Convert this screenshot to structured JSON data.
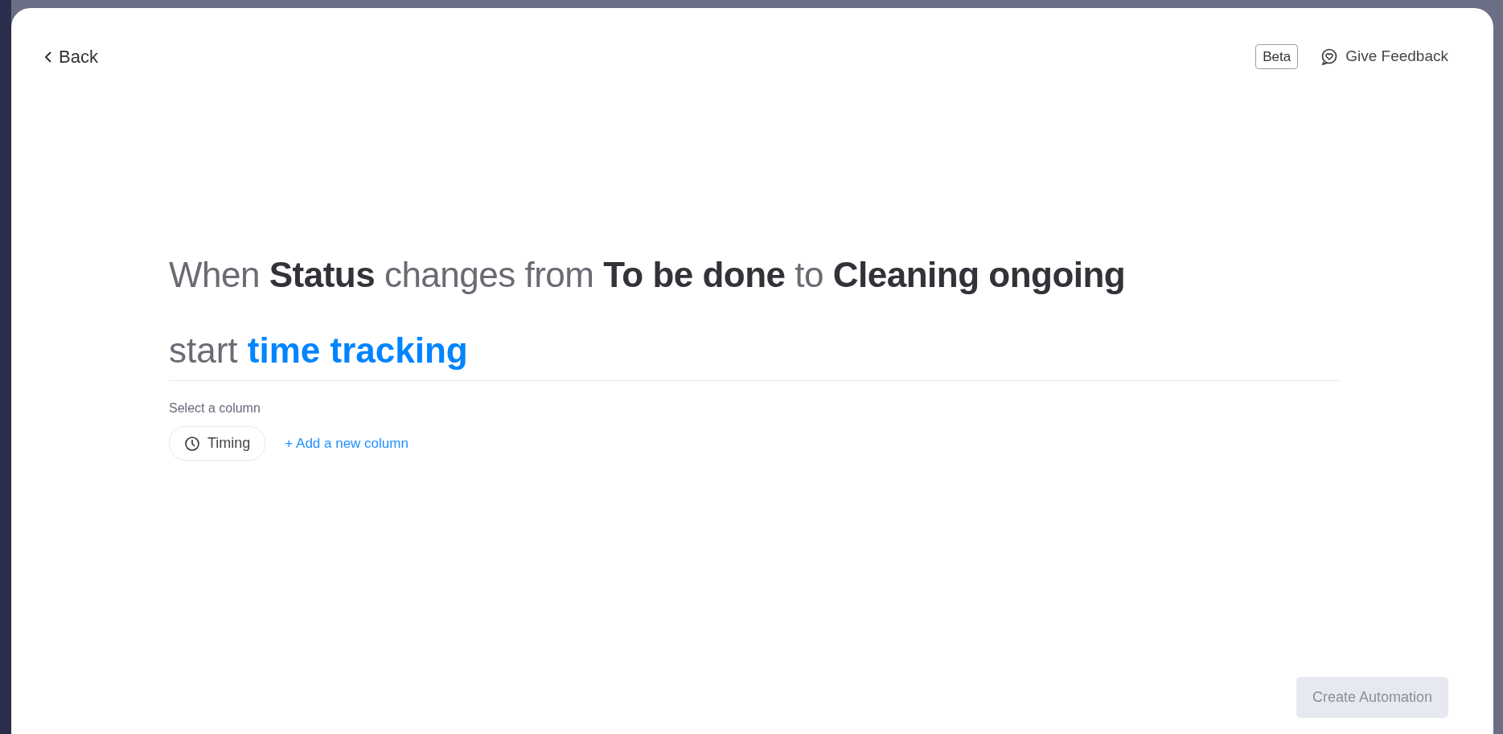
{
  "back": {
    "label": "Back"
  },
  "badge": "Beta",
  "feedback": {
    "label": "Give Feedback"
  },
  "trigger": "When **Status** changes from **To be done** to **Cleaning ongoing**",
  "action": {
    "verb": "start",
    "name": "time tracking"
  },
  "column_select": {
    "label": "Select a column",
    "columns": [
      {
        "label": "Timing"
      }
    ],
    "add_link": "+ Add a new column"
  },
  "create_button": {
    "label": "Create Automation",
    "disabled": true
  }
}
